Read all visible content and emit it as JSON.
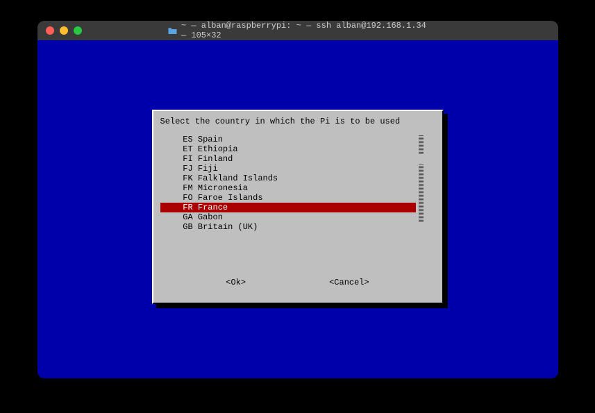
{
  "window": {
    "title": "~ — alban@raspberrypi: ~ — ssh alban@192.168.1.34 — 105×32"
  },
  "dialog": {
    "prompt": "Select the country in which the Pi is to be used",
    "items": [
      {
        "code": "ES",
        "name": "Spain",
        "selected": false
      },
      {
        "code": "ET",
        "name": "Ethiopia",
        "selected": false
      },
      {
        "code": "FI",
        "name": "Finland",
        "selected": false
      },
      {
        "code": "FJ",
        "name": "Fiji",
        "selected": false
      },
      {
        "code": "FK",
        "name": "Falkland Islands",
        "selected": false
      },
      {
        "code": "FM",
        "name": "Micronesia",
        "selected": false
      },
      {
        "code": "FO",
        "name": "Faroe Islands",
        "selected": false
      },
      {
        "code": "FR",
        "name": "France",
        "selected": true
      },
      {
        "code": "GA",
        "name": "Gabon",
        "selected": false
      },
      {
        "code": "GB",
        "name": "Britain (UK)",
        "selected": false
      }
    ],
    "ok_label": "<Ok>",
    "cancel_label": "<Cancel>"
  }
}
